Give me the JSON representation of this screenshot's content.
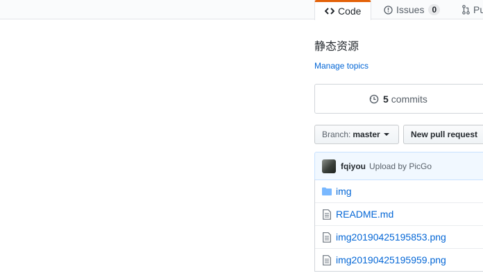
{
  "tabs": [
    {
      "label": "Code",
      "icon": "code-icon",
      "selected": true
    },
    {
      "label": "Issues",
      "icon": "issue-icon",
      "count": "0",
      "selected": false
    },
    {
      "label": "Pu",
      "icon": "pull-request-icon",
      "selected": false
    }
  ],
  "repo": {
    "description": "静态资源",
    "manage_topics": "Manage topics"
  },
  "summary": {
    "commits_count": "5",
    "commits_label": "commits"
  },
  "toolbar": {
    "branch_prefix": "Branch:",
    "branch_name": "master",
    "new_pr_label": "New pull request"
  },
  "latest_commit": {
    "author": "fqiyou",
    "message": "Upload by PicGo"
  },
  "files": [
    {
      "name": "img",
      "type": "directory"
    },
    {
      "name": "README.md",
      "type": "file"
    },
    {
      "name": "img20190425195853.png",
      "type": "file"
    },
    {
      "name": "img20190425195959.png",
      "type": "file"
    }
  ],
  "colors": {
    "accent": "#e36209",
    "link": "#0366d6",
    "commit_bg": "#f1f8ff",
    "folder": "#79b8ff"
  }
}
